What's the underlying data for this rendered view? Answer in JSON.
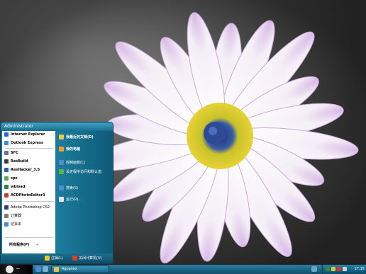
{
  "start_menu": {
    "user_name": "Administrator",
    "pinned_items": [
      {
        "label": "Internet Explorer",
        "icon": "internet-explorer-icon",
        "color": "#2a62c9"
      },
      {
        "label": "Outlook Express",
        "icon": "outlook-express-icon",
        "color": "#3a8fd6"
      }
    ],
    "recent_items": [
      {
        "label": "SFC",
        "icon": "sfc-icon",
        "color": "#6b6bb8"
      },
      {
        "label": "ResBuild",
        "icon": "resbuild-icon",
        "color": "#3b3b3b"
      },
      {
        "label": "ResHacker_3.5",
        "icon": "reshacker-icon",
        "color": "#2e5fa8"
      },
      {
        "label": "spx",
        "icon": "spx-icon",
        "color": "#6aa04a"
      },
      {
        "label": "wbload",
        "icon": "wbload-icon",
        "color": "#2f8a3a"
      },
      {
        "label": "ACDPhotoEditor3",
        "icon": "acd-photo-editor-icon",
        "color": "#c43a2a"
      },
      {
        "label": "Adobe Photoshop CS2",
        "icon": "photoshop-icon",
        "color": "#3a3a7a"
      },
      {
        "label": "计算器",
        "icon": "calculator-icon",
        "color": "#7a7a7a"
      },
      {
        "label": "记事本",
        "icon": "notepad-icon",
        "color": "#3f8fd0"
      }
    ],
    "all_programs": "所有程序(P)",
    "right_items": [
      {
        "label": "我最近的文档(D)",
        "icon": "recent-documents-icon",
        "color": "#e9c84a"
      },
      {
        "label": "我的电脑",
        "icon": "my-computer-icon",
        "color": "#f0a030"
      },
      {
        "label": "控制面板(C)",
        "icon": "control-panel-icon",
        "color": "#4f8fd0"
      },
      {
        "label": "设定程序访问和默认值",
        "icon": "program-access-icon",
        "color": "#5fb04a"
      },
      {
        "label": "搜索(S)",
        "icon": "search-icon",
        "color": "#4b8fd8"
      },
      {
        "label": "运行(R)...",
        "icon": "run-icon",
        "color": "#e6e6e6"
      }
    ],
    "logoff_label": "注销(L)",
    "shutdown_label": "关闭计算机(U)"
  },
  "taskbar": {
    "task_button": "Aquanox",
    "clock": "17:15",
    "start_color": "#000000",
    "bar_color": "#1a6d8f"
  }
}
